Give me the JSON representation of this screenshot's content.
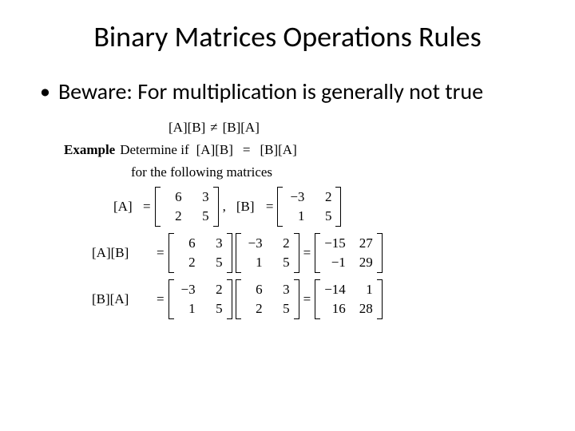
{
  "title": "Binary Matrices Operations Rules",
  "bullet": "Beware: For multiplication is generally not true",
  "rule": {
    "lhs": "[A][B]",
    "op": "≠",
    "rhs": "[B][A]"
  },
  "example": {
    "label": "Example",
    "prompt": "Determine if",
    "eq_lhs": "[A][B]",
    "eq_op": "=",
    "eq_rhs": "[B][A]",
    "for_text": "for the following matrices"
  },
  "defs": {
    "A_label": "[A]",
    "A": [
      [
        "6",
        "3"
      ],
      [
        "2",
        "5"
      ]
    ],
    "sep": ",",
    "B_label": "[B]",
    "B": [
      [
        "−3",
        "2"
      ],
      [
        "1",
        "5"
      ]
    ]
  },
  "prod1": {
    "label": "[A][B]",
    "m1": [
      [
        "6",
        "3"
      ],
      [
        "2",
        "5"
      ]
    ],
    "m2": [
      [
        "−3",
        "2"
      ],
      [
        "1",
        "5"
      ]
    ],
    "res": [
      [
        "−15",
        "27"
      ],
      [
        "−1",
        "29"
      ]
    ]
  },
  "prod2": {
    "label": "[B][A]",
    "m1": [
      [
        "−3",
        "2"
      ],
      [
        "1",
        "5"
      ]
    ],
    "m2": [
      [
        "6",
        "3"
      ],
      [
        "2",
        "5"
      ]
    ],
    "res": [
      [
        "−14",
        "1"
      ],
      [
        "16",
        "28"
      ]
    ]
  },
  "eq": "="
}
